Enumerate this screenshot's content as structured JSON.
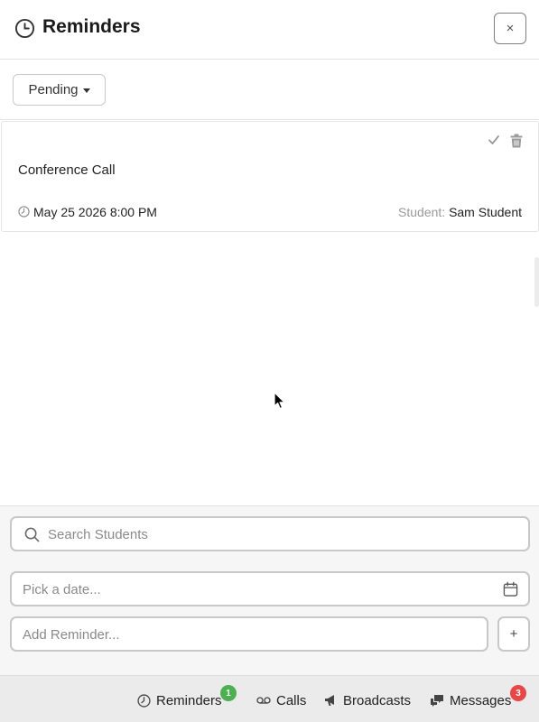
{
  "header": {
    "title": "Reminders",
    "close_label": "×"
  },
  "filter": {
    "selected": "Pending"
  },
  "reminders": [
    {
      "title": "Conference Call",
      "datetime": "May 25 2026 8:00 PM",
      "student_label": "Student:",
      "student_name": "Sam Student"
    }
  ],
  "form": {
    "search_placeholder": "Search Students",
    "date_placeholder": "Pick a date...",
    "reminder_placeholder": "Add Reminder...",
    "add_label": "+"
  },
  "taskbar": {
    "tabs": [
      {
        "label": "Reminders",
        "icon": "clock-icon",
        "badge": "1",
        "badge_color": "#4caf50"
      },
      {
        "label": "Calls",
        "icon": "voicemail-icon"
      },
      {
        "label": "Broadcasts",
        "icon": "megaphone-icon"
      },
      {
        "label": "Messages",
        "icon": "chat-bubbles-icon",
        "badge": "3",
        "badge_color": "#e84747"
      }
    ]
  },
  "colors": {
    "success": "#4caf50",
    "danger": "#e84747",
    "border": "#c8c8c8"
  }
}
